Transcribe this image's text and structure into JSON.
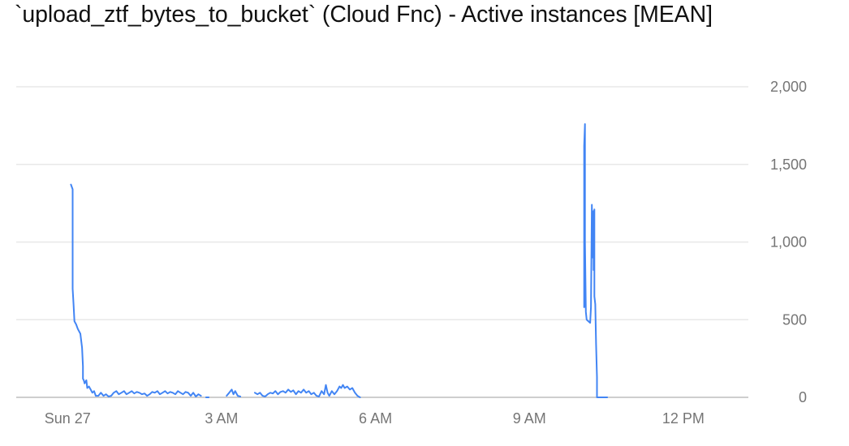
{
  "chart_data": {
    "type": "line",
    "title": "`upload_ztf_bytes_to_bucket` (Cloud Fnc) - Active instances [MEAN]",
    "xlabel": "",
    "ylabel": "",
    "ylim": [
      0,
      2000
    ],
    "xlim": [
      "2020-09-26T23:00",
      "2020-09-27T13:16"
    ],
    "grid": "horizontal",
    "legend": "none",
    "y_axis_side": "right",
    "y_ticks": [
      {
        "value": 0,
        "label": "0"
      },
      {
        "value": 500,
        "label": "500"
      },
      {
        "value": 1000,
        "label": "1,000"
      },
      {
        "value": 1500,
        "label": "1,500"
      },
      {
        "value": 2000,
        "label": "2,000"
      }
    ],
    "x_ticks": [
      {
        "value": "2020-09-27T00:00",
        "label": "Sun 27"
      },
      {
        "value": "2020-09-27T03:00",
        "label": "3 AM"
      },
      {
        "value": "2020-09-27T06:00",
        "label": "6 AM"
      },
      {
        "value": "2020-09-27T09:00",
        "label": "9 AM"
      },
      {
        "value": "2020-09-27T12:00",
        "label": "12 PM"
      }
    ],
    "series": [
      {
        "color": "#4285f4",
        "segments": [
          [
            [
              "2020-09-27T00:04",
              1370
            ],
            [
              "2020-09-27T00:06",
              1340
            ],
            [
              "2020-09-27T00:06",
              700
            ],
            [
              "2020-09-27T00:07",
              600
            ],
            [
              "2020-09-27T00:08",
              490
            ],
            [
              "2020-09-27T00:10",
              470
            ],
            [
              "2020-09-27T00:12",
              440
            ],
            [
              "2020-09-27T00:15",
              410
            ],
            [
              "2020-09-27T00:17",
              320
            ],
            [
              "2020-09-27T00:18",
              200
            ],
            [
              "2020-09-27T00:18",
              120
            ],
            [
              "2020-09-27T00:19",
              110
            ],
            [
              "2020-09-27T00:20",
              90
            ],
            [
              "2020-09-27T00:22",
              110
            ],
            [
              "2020-09-27T00:23",
              60
            ],
            [
              "2020-09-27T00:25",
              70
            ],
            [
              "2020-09-27T00:27",
              50
            ],
            [
              "2020-09-27T00:29",
              30
            ],
            [
              "2020-09-27T00:31",
              40
            ],
            [
              "2020-09-27T00:33",
              10
            ],
            [
              "2020-09-27T00:36",
              10
            ],
            [
              "2020-09-27T00:39",
              30
            ],
            [
              "2020-09-27T00:42",
              10
            ],
            [
              "2020-09-27T00:45",
              20
            ],
            [
              "2020-09-27T00:48",
              5
            ],
            [
              "2020-09-27T00:51",
              10
            ],
            [
              "2020-09-27T00:54",
              30
            ],
            [
              "2020-09-27T00:57",
              40
            ],
            [
              "2020-09-27T01:00",
              20
            ],
            [
              "2020-09-27T01:03",
              30
            ],
            [
              "2020-09-27T01:06",
              40
            ],
            [
              "2020-09-27T01:09",
              20
            ],
            [
              "2020-09-27T01:12",
              30
            ],
            [
              "2020-09-27T01:15",
              40
            ],
            [
              "2020-09-27T01:18",
              25
            ],
            [
              "2020-09-27T01:21",
              35
            ],
            [
              "2020-09-27T01:24",
              30
            ],
            [
              "2020-09-27T01:27",
              20
            ],
            [
              "2020-09-27T01:30",
              25
            ],
            [
              "2020-09-27T01:33",
              10
            ],
            [
              "2020-09-27T01:36",
              20
            ],
            [
              "2020-09-27T01:39",
              35
            ],
            [
              "2020-09-27T01:42",
              30
            ],
            [
              "2020-09-27T01:45",
              40
            ],
            [
              "2020-09-27T01:48",
              20
            ],
            [
              "2020-09-27T01:51",
              30
            ],
            [
              "2020-09-27T01:54",
              40
            ],
            [
              "2020-09-27T01:57",
              25
            ],
            [
              "2020-09-27T02:00",
              35
            ],
            [
              "2020-09-27T02:03",
              30
            ],
            [
              "2020-09-27T02:06",
              20
            ],
            [
              "2020-09-27T02:09",
              40
            ],
            [
              "2020-09-27T02:12",
              30
            ],
            [
              "2020-09-27T02:15",
              20
            ],
            [
              "2020-09-27T02:18",
              35
            ],
            [
              "2020-09-27T02:21",
              30
            ],
            [
              "2020-09-27T02:24",
              10
            ],
            [
              "2020-09-27T02:27",
              30
            ],
            [
              "2020-09-27T02:30",
              5
            ],
            [
              "2020-09-27T02:33",
              20
            ],
            [
              "2020-09-27T02:36",
              10
            ]
          ],
          [
            [
              "2020-09-27T02:42",
              0
            ],
            [
              "2020-09-27T02:45",
              0
            ]
          ],
          [
            [
              "2020-09-27T03:06",
              10
            ],
            [
              "2020-09-27T03:09",
              30
            ],
            [
              "2020-09-27T03:12",
              50
            ],
            [
              "2020-09-27T03:14",
              20
            ],
            [
              "2020-09-27T03:16",
              40
            ],
            [
              "2020-09-27T03:19",
              10
            ],
            [
              "2020-09-27T03:22",
              5
            ]
          ],
          [
            [
              "2020-09-27T03:39",
              30
            ],
            [
              "2020-09-27T03:42",
              20
            ],
            [
              "2020-09-27T03:45",
              30
            ],
            [
              "2020-09-27T03:48",
              10
            ],
            [
              "2020-09-27T03:51",
              5
            ],
            [
              "2020-09-27T03:54",
              20
            ],
            [
              "2020-09-27T03:57",
              30
            ],
            [
              "2020-09-27T04:00",
              25
            ],
            [
              "2020-09-27T04:03",
              40
            ],
            [
              "2020-09-27T04:06",
              20
            ],
            [
              "2020-09-27T04:09",
              35
            ],
            [
              "2020-09-27T04:12",
              40
            ],
            [
              "2020-09-27T04:15",
              30
            ],
            [
              "2020-09-27T04:18",
              50
            ],
            [
              "2020-09-27T04:21",
              35
            ],
            [
              "2020-09-27T04:24",
              45
            ],
            [
              "2020-09-27T04:27",
              20
            ],
            [
              "2020-09-27T04:30",
              40
            ],
            [
              "2020-09-27T04:33",
              30
            ],
            [
              "2020-09-27T04:36",
              50
            ],
            [
              "2020-09-27T04:39",
              30
            ],
            [
              "2020-09-27T04:42",
              40
            ],
            [
              "2020-09-27T04:45",
              20
            ],
            [
              "2020-09-27T04:48",
              30
            ],
            [
              "2020-09-27T04:51",
              10
            ],
            [
              "2020-09-27T04:54",
              5
            ],
            [
              "2020-09-27T04:57",
              40
            ],
            [
              "2020-09-27T05:00",
              20
            ],
            [
              "2020-09-27T05:02",
              80
            ],
            [
              "2020-09-27T05:04",
              30
            ],
            [
              "2020-09-27T05:06",
              10
            ],
            [
              "2020-09-27T05:09",
              40
            ],
            [
              "2020-09-27T05:12",
              20
            ],
            [
              "2020-09-27T05:15",
              40
            ],
            [
              "2020-09-27T05:18",
              70
            ],
            [
              "2020-09-27T05:20",
              60
            ],
            [
              "2020-09-27T05:22",
              80
            ],
            [
              "2020-09-27T05:24",
              60
            ],
            [
              "2020-09-27T05:27",
              70
            ],
            [
              "2020-09-27T05:30",
              50
            ],
            [
              "2020-09-27T05:33",
              60
            ],
            [
              "2020-09-27T05:36",
              30
            ],
            [
              "2020-09-27T05:39",
              10
            ],
            [
              "2020-09-27T05:42",
              0
            ]
          ],
          [
            [
              "2020-09-27T10:04",
              580
            ],
            [
              "2020-09-27T10:04",
              1620
            ],
            [
              "2020-09-27T10:05",
              1760
            ],
            [
              "2020-09-27T10:05",
              1000
            ],
            [
              "2020-09-27T10:06",
              550
            ],
            [
              "2020-09-27T10:07",
              500
            ],
            [
              "2020-09-27T10:09",
              490
            ],
            [
              "2020-09-27T10:11",
              480
            ],
            [
              "2020-09-27T10:12",
              580
            ],
            [
              "2020-09-27T10:13",
              1240
            ],
            [
              "2020-09-27T10:14",
              900
            ],
            [
              "2020-09-27T10:15",
              1200
            ],
            [
              "2020-09-27T10:15",
              820
            ],
            [
              "2020-09-27T10:16",
              1210
            ],
            [
              "2020-09-27T10:16",
              650
            ],
            [
              "2020-09-27T10:17",
              600
            ],
            [
              "2020-09-27T10:18",
              340
            ],
            [
              "2020-09-27T10:19",
              130
            ],
            [
              "2020-09-27T10:19",
              0
            ],
            [
              "2020-09-27T10:23",
              0
            ],
            [
              "2020-09-27T10:28",
              0
            ],
            [
              "2020-09-27T10:31",
              0
            ]
          ]
        ]
      }
    ]
  }
}
